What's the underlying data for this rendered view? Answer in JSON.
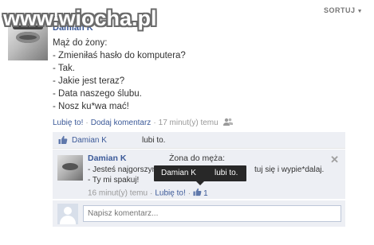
{
  "watermark": "www.wiocha.pl",
  "sort_label": "SORTUJ",
  "post": {
    "author": "Damian K",
    "lines": [
      "Mąż do żony:",
      "- Zmieniłaś hasło do komputera?",
      "- Tak.",
      "- Jakie jest teraz?",
      "- Data naszego ślubu.",
      "- Nosz ku*wa mać!"
    ],
    "like_link": "Lubię to!",
    "comment_link": "Dodaj komentarz",
    "time": "17 minut(y) temu"
  },
  "likes": {
    "name": "Damian K",
    "suffix": "lubi to."
  },
  "comment": {
    "author": "Damian K",
    "heading": "Żona do męża:",
    "line1_start": "- Jesteś najgorszym",
    "line1_end": "tuj się i wypie*dalaj.",
    "line2": "- Ty mi spakuj!",
    "time": "16 minut(y) temu",
    "like_link": "Lubię to!",
    "like_count": "1"
  },
  "tooltip": {
    "name": "Damian K",
    "suffix": "lubi to."
  },
  "write_comment": {
    "placeholder": "Napisz komentarz..."
  },
  "colors": {
    "link": "#3b5998",
    "panel": "#edeff4",
    "tooltip_bg": "#282828"
  }
}
